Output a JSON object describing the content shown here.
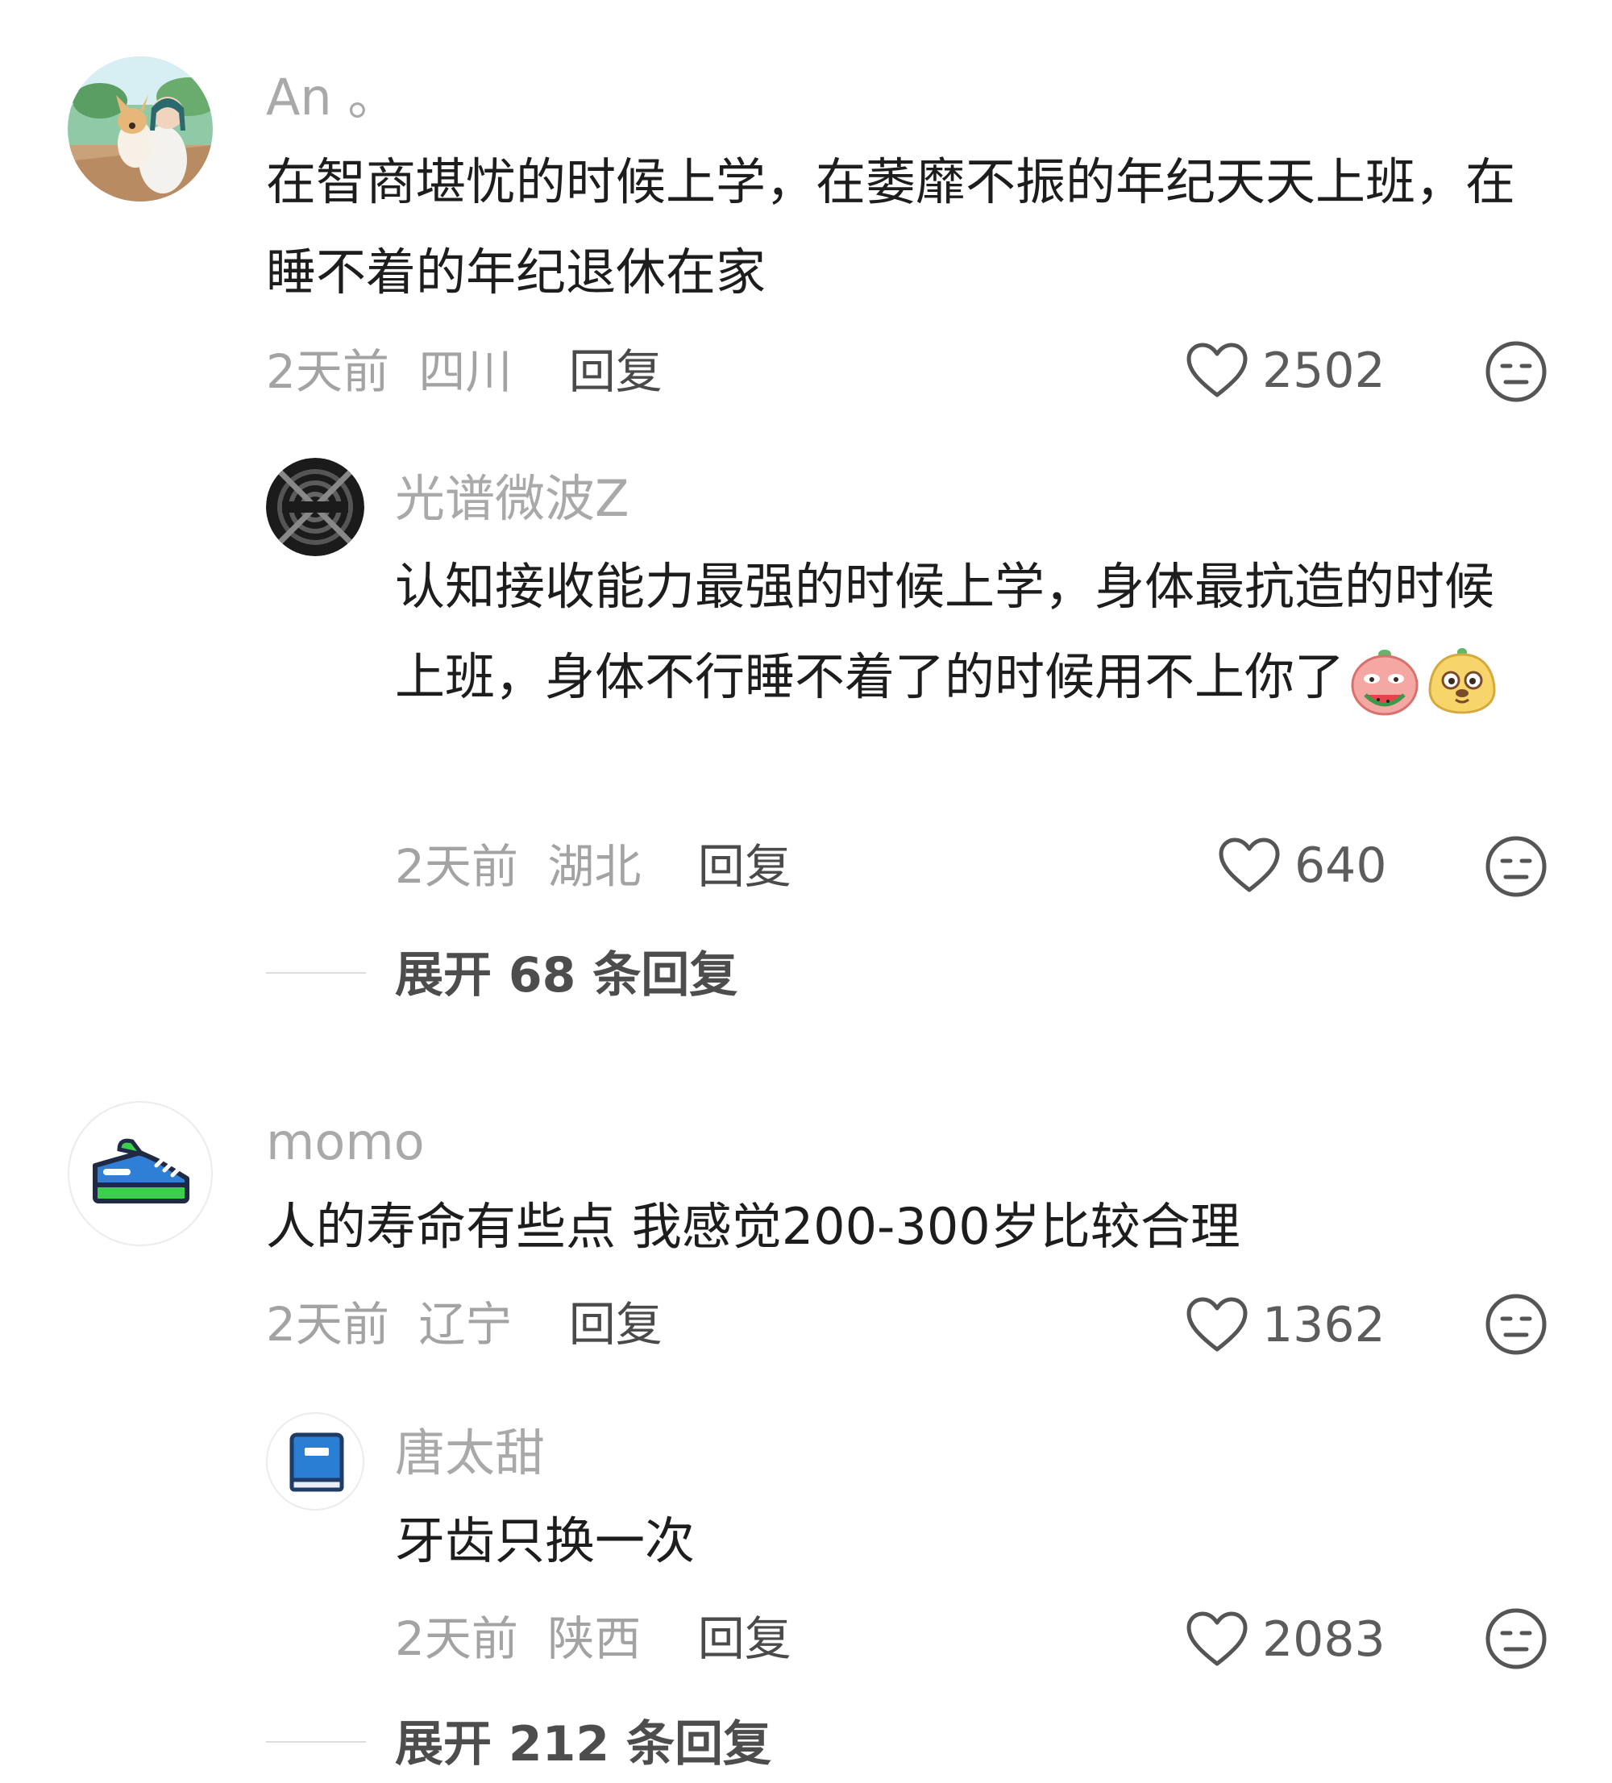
{
  "comments": [
    {
      "username": "An 。",
      "avatar_icon": "person-with-dog-avatar",
      "text": "在智商堪忧的时候上学，在萎靡不振的年纪天天上班，在睡不着的年纪退休在家",
      "time": "2天前",
      "location": "四川",
      "reply_label": "回复",
      "likes": "2502",
      "reply": {
        "username": "光谱微波Z",
        "avatar_icon": "dark-circle-logo-avatar",
        "text": "认知接收能力最强的时候上学，身体最抗造的时候上班，身体不行睡不着了的时候用不上你了",
        "emojis": [
          "watermelon-eating-emoji",
          "smug-dog-emoji"
        ],
        "time": "2天前",
        "location": "湖北",
        "reply_label": "回复",
        "likes": "640"
      },
      "expand_label": "展开 68 条回复"
    },
    {
      "username": "momo",
      "avatar_icon": "sneaker-avatar",
      "text": "人的寿命有些点 我感觉200-300岁比较合理",
      "time": "2天前",
      "location": "辽宁",
      "reply_label": "回复",
      "likes": "1362",
      "reply": {
        "username": "唐太甜",
        "avatar_icon": "blue-book-avatar",
        "text": "牙齿只换一次",
        "time": "2天前",
        "location": "陕西",
        "reply_label": "回复",
        "likes": "2083"
      },
      "expand_label": "展开 212 条回复"
    }
  ],
  "colors": {
    "text": "#1d1d1d",
    "meta": "#a3a3a3",
    "username": "#a9a9a9",
    "icon": "#555555"
  }
}
